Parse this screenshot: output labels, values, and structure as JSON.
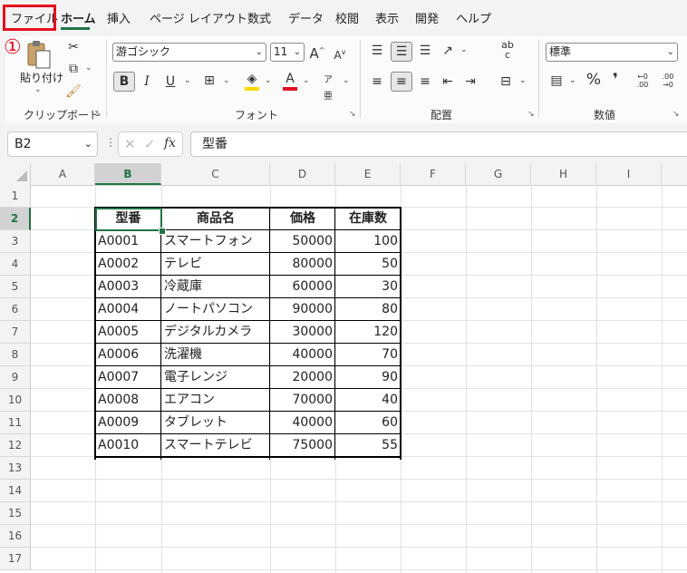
{
  "tabs": [
    "ファイル",
    "ホーム",
    "挿入",
    "ページ レイアウト",
    "数式",
    "データ",
    "校閲",
    "表示",
    "開発",
    "ヘルプ"
  ],
  "annotation": "①",
  "ribbon": {
    "paste_label": "貼り付け",
    "groups": {
      "clipboard": "クリップボード",
      "font": "フォント",
      "alignment": "配置",
      "number": "数値"
    },
    "font_name": "游ゴシック",
    "font_size": "11",
    "number_format": "標準",
    "bold": "B",
    "italic": "I",
    "underline": "U",
    "grow_font": "A",
    "shrink_font": "A",
    "percent": "%",
    "comma": "❜",
    "inc_decimal": "←0 .00",
    "dec_decimal": ".00 →0",
    "wrap_icon": "ab c"
  },
  "formula_bar": {
    "name_box": "B2",
    "fx": "fx",
    "content": "型番"
  },
  "columns": [
    "A",
    "B",
    "C",
    "D",
    "E",
    "F",
    "G",
    "H",
    "I"
  ],
  "rows": [
    "1",
    "2",
    "3",
    "4",
    "5",
    "6",
    "7",
    "8",
    "9",
    "10",
    "11",
    "12",
    "13",
    "14",
    "15",
    "16",
    "17"
  ],
  "table": {
    "headers": [
      "型番",
      "商品名",
      "価格",
      "在庫数"
    ],
    "rows": [
      [
        "A0001",
        "スマートフォン",
        "50000",
        "100"
      ],
      [
        "A0002",
        "テレビ",
        "80000",
        "50"
      ],
      [
        "A0003",
        "冷蔵庫",
        "60000",
        "30"
      ],
      [
        "A0004",
        "ノートパソコン",
        "90000",
        "80"
      ],
      [
        "A0005",
        "デジタルカメラ",
        "30000",
        "120"
      ],
      [
        "A0006",
        "洗濯機",
        "40000",
        "70"
      ],
      [
        "A0007",
        "電子レンジ",
        "20000",
        "90"
      ],
      [
        "A0008",
        "エアコン",
        "70000",
        "40"
      ],
      [
        "A0009",
        "タブレット",
        "40000",
        "60"
      ],
      [
        "A0010",
        "スマートテレビ",
        "75000",
        "55"
      ]
    ]
  },
  "colors": {
    "accent": "#217346",
    "highlight": "#e3111e",
    "font_color": "#e3111e",
    "fill_color": "#ffd700"
  }
}
